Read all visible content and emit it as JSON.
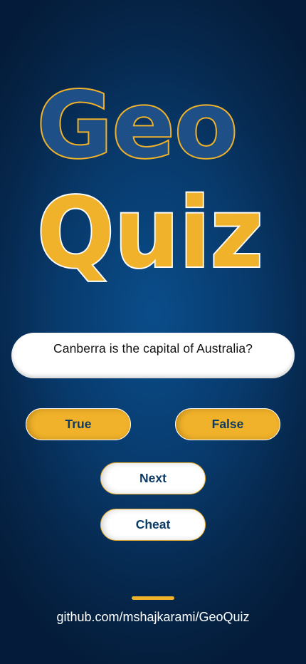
{
  "app": {
    "logo_line1": "Geo",
    "logo_line2": "Quiz"
  },
  "question": {
    "text": "Canberra is the capital of Australia?"
  },
  "answers": {
    "true_label": "True",
    "false_label": "False"
  },
  "navigation": {
    "next_label": "Next",
    "cheat_label": "Cheat"
  },
  "footer": {
    "repo_link": "github.com/mshajkarami/GeoQuiz"
  },
  "colors": {
    "background": "#083a6c",
    "accent_gold": "#f0b22a",
    "logo_blue": "#1e4f86",
    "button_text": "#0b3b66",
    "card": "#ffffff"
  }
}
